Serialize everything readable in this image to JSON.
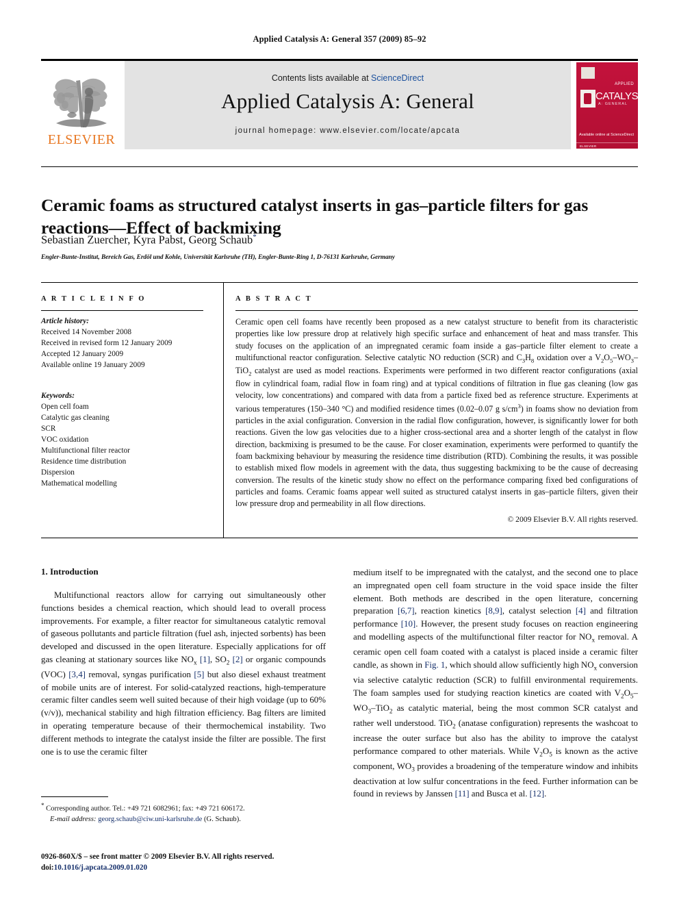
{
  "running_head": "Applied Catalysis A: General 357 (2009) 85–92",
  "masthead": {
    "contents_prefix": "Contents lists available at ",
    "sciencedirect": "ScienceDirect",
    "journal_name": "Applied Catalysis A: General",
    "homepage": "journal homepage: www.elsevier.com/locate/apcata",
    "publisher_wordmark": "ELSEVIER",
    "cover": {
      "applied": "APPLIED",
      "catalysis": "CATALYSIS",
      "general": "A: GENERAL",
      "sciencedirect_note": "Available online at\nScienceDirect",
      "publisher": "ELSEVIER"
    },
    "link_color": "#1a4f9c",
    "brand_orange": "#e87722",
    "cover_red": "#c0123a"
  },
  "article": {
    "title": "Ceramic foams as structured catalyst inserts in gas–particle filters for gas reactions—Effect of backmixing",
    "authors": "Sebastian Zuercher, Kyra Pabst, Georg Schaub",
    "author_marker": "*",
    "affiliation": "Engler-Bunte-Institut, Bereich Gas, Erdöl und Kohle, Universität Karlsruhe (TH), Engler-Bunte-Ring 1, D-76131 Karlsruhe, Germany"
  },
  "info": {
    "heading": "A R T I C L E   I N F O",
    "history_label": "Article history:",
    "history": [
      "Received 14 November 2008",
      "Received in revised form 12 January 2009",
      "Accepted 12 January 2009",
      "Available online 19 January 2009"
    ],
    "keywords_label": "Keywords:",
    "keywords": [
      "Open cell foam",
      "Catalytic gas cleaning",
      "SCR",
      "VOC oxidation",
      "Multifunctional filter reactor",
      "Residence time distribution",
      "Dispersion",
      "Mathematical modelling"
    ]
  },
  "abstract": {
    "heading": "A B S T R A C T",
    "paragraph_1": "Ceramic open cell foams have recently been proposed as a new catalyst structure to benefit from its characteristic properties like low pressure drop at relatively high specific surface and enhancement of heat and mass transfer. This study focuses on the application of an impregnated ceramic foam inside a gas–particle filter element to create a multifunctional reactor configuration. Selective catalytic NO reduction (SCR) and ",
    "formula_c3h8": "C3H8",
    "paragraph_2": " oxidation over a ",
    "formula_catalyst": "V2O5–WO3–TiO2",
    "paragraph_3": " catalyst are used as model reactions. Experiments were performed in two different reactor configurations (axial flow in cylindrical foam, radial flow in foam ring) and at typical conditions of filtration in flue gas cleaning (low gas velocity, low concentrations) and compared with data from a particle fixed bed as reference structure. Experiments at various temperatures (150–340 °C) and modified residence times (0.02–0.07 g s/cm",
    "exponent_3": "3",
    "paragraph_4": ") in foams show no deviation from particles in the axial configuration. Conversion in the radial flow configuration, however, is significantly lower for both reactions. Given the low gas velocities due to a higher cross-sectional area and a shorter length of the catalyst in flow direction, backmixing is presumed to be the cause. For closer examination, experiments were performed to quantify the foam backmixing behaviour by measuring the residence time distribution (RTD). Combining the results, it was possible to establish mixed flow models in agreement with the data, thus suggesting backmixing to be the cause of decreasing conversion. The results of the kinetic study show no effect on the performance comparing fixed bed configurations of particles and foams. Ceramic foams appear well suited as structured catalyst inserts in gas–particle filters, given their low pressure drop and permeability in all flow directions.",
    "copyright": "© 2009 Elsevier B.V. All rights reserved."
  },
  "body": {
    "section_number_title": "1. Introduction",
    "left_p1_a": "Multifunctional reactors allow for carrying out simultaneously other functions besides a chemical reaction, which should lead to overall process improvements. For example, a filter reactor for simultaneous catalytic removal of gaseous pollutants and particle filtration (fuel ash, injected sorbents) has been developed and discussed in the open literature. Especially applications for off gas cleaning at stationary sources like NO",
    "left_nox_sub": "x",
    "left_p1_b": " ",
    "ref_1": "[1]",
    "left_p1_c": ", SO",
    "left_so2_sub": "2",
    "left_p1_d": " ",
    "ref_2": "[2]",
    "left_p1_e": " or organic compounds (VOC) ",
    "ref_34": "[3,4]",
    "left_p1_f": " removal, syngas purification ",
    "ref_5": "[5]",
    "left_p1_g": " but also diesel exhaust treatment of mobile units are of interest. For solid-catalyzed reactions, high-temperature ceramic filter candles seem well suited because of their high voidage (up to 60% (v/v)), mechanical stability and high filtration efficiency. Bag filters are limited in operating temperature because of their thermochemical instability. Two different methods to integrate the catalyst inside the filter are possible. The first one is to use the ceramic filter",
    "right_p1_a": "medium itself to be impregnated with the catalyst, and the second one to place an impregnated open cell foam structure in the void space inside the filter element. Both methods are described in the open literature, concerning preparation ",
    "ref_67": "[6,7]",
    "right_p1_b": ", reaction kinetics ",
    "ref_89": "[8,9]",
    "right_p1_c": ", catalyst selection ",
    "ref_4": "[4]",
    "right_p1_d": " and filtration performance ",
    "ref_10": "[10]",
    "right_p1_e": ". However, the present study focuses on reaction engineering and modelling aspects of the multifunctional filter reactor for NO",
    "right_nox_sub": "x",
    "right_p1_f": " removal. A ceramic open cell foam coated with a catalyst is placed inside a ceramic filter candle, as shown in ",
    "fig_ref": "Fig. 1",
    "right_p1_g": ", which should allow sufficiently high NO",
    "right_nox_sub2": "x",
    "right_p1_h": " conversion via selective catalytic reduction (SCR) to fulfill environmental requirements. The foam samples used for studying reaction kinetics are coated with V",
    "v2o5_sub1": "2",
    "right_p1_i": "O",
    "v2o5_sub2": "5",
    "right_p1_j": "–WO",
    "wo3_sub": "3",
    "right_p1_k": "–TiO",
    "tio2_sub": "2",
    "right_p1_l": " as catalytic material, being the most common SCR catalyst and rather well understood. TiO",
    "tio2_sub2": "2",
    "right_p1_m": " (anatase configuration) represents the washcoat to increase the outer surface but also has the ability to improve the catalyst performance compared to other materials. While V",
    "v2o5b_sub1": "2",
    "right_p1_n": "O",
    "v2o5b_sub2": "5",
    "right_p1_o": " is known as the active component, WO",
    "wo3b_sub": "3",
    "right_p1_p": " provides a broadening of the temperature window and inhibits deactivation at low sulfur concentrations in the feed. Further information can be found in reviews by Janssen ",
    "ref_11": "[11]",
    "right_p1_q": " and Busca et al. ",
    "ref_12": "[12]",
    "right_p1_r": "."
  },
  "footnotes": {
    "corresponding": "Corresponding author. Tel.: +49 721 6082961; fax: +49 721 606172.",
    "email_label": "E-mail address:",
    "email": "georg.schaub@ciw.uni-karlsruhe.de",
    "email_suffix": "(G. Schaub).",
    "frontmatter": "0926-860X/$ – see front matter © 2009 Elsevier B.V. All rights reserved.",
    "doi_label": "doi:",
    "doi": "10.1016/j.apcata.2009.01.020"
  }
}
